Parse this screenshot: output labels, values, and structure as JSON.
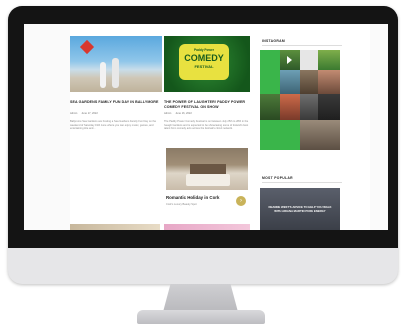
{
  "articles": [
    {
      "title": "Sea Gardens Family Fun Day in Ballymore",
      "meta_author": "Admin",
      "meta_date": "June 17, 2022",
      "excerpt": "Ballymore Sea Gardens are hosting a Sea Gardens Family Fun Day on the weekend of Saturday 19th June where you can enjoy music, games, and entertaining kite and..."
    },
    {
      "title": "The Power of Laughter! Paddy Power Comedy Festival on Show",
      "meta_author": "Admin",
      "meta_date": "June 16, 2022",
      "excerpt": "The Paddy Power Comedy Festival is on between July 25th to 28th in the Iveagh Gardens and is expected to be showcasing some of Ireland's best talent from comedy acts across the festival's circuit network."
    }
  ],
  "comedy_badge": {
    "line1": "Paddy Power",
    "line2": "COMEDY",
    "line3": "FESTIVAL"
  },
  "featured": {
    "title": "Romantic Holiday in Cork",
    "subtitle": "Cork's Luxury Beauty Spot",
    "arrow": "›"
  },
  "sidebar": {
    "instagram_heading": "INSTAGRAM",
    "popular_heading": "MOST POPULAR",
    "popular_caption": "DEANNE WEST'S ADVICE TO HELP YOU WALK WITH ARIANA MARTIN PURE ENERGY"
  },
  "colors": {
    "bezel": "#141414",
    "monitor_chin": "#e6e6e8",
    "insta_green": "#3ab54a",
    "accent_gold": "#c9b35a"
  }
}
